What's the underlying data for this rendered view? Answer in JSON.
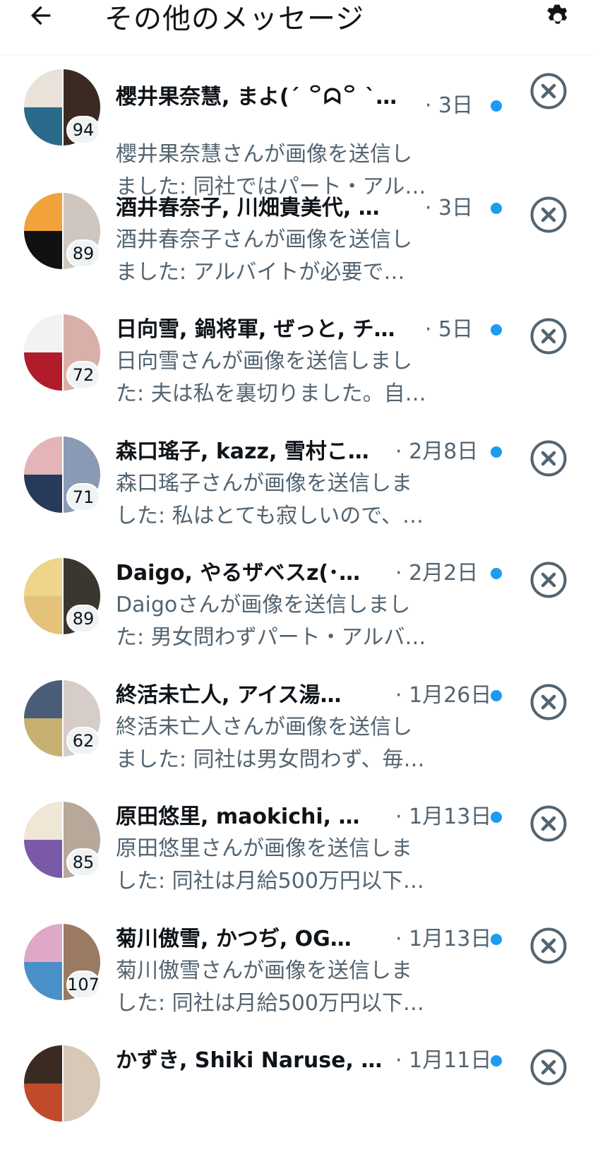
{
  "header": {
    "title": "その他のメッセージ",
    "back_icon": "arrow-left-icon",
    "settings_icon": "gear-icon"
  },
  "colors": {
    "unread_dot": "#1d9bf0",
    "muted_text": "#536471",
    "close_icon": "#536471"
  },
  "conversations": [
    {
      "names": "櫻井果奈慧, まよ(´ ꒪ᗣ꒪ `)…",
      "time": "· 3日",
      "preview_line1": "櫻井果奈慧さんが画像を送信し",
      "preview_line2": "ました: 同社ではパート・アル…",
      "member_count": "94",
      "unread": true
    },
    {
      "names": "酒井春奈子, 川畑貴美代, …",
      "time": "· 3日",
      "preview_line1": "酒井春奈子さんが画像を送信し",
      "preview_line2": "ました: アルバイトが必要で…",
      "member_count": "89",
      "unread": true
    },
    {
      "names": "日向雪, 鍋将軍, ぜっと, チ…",
      "time": "· 5日",
      "preview_line1": "日向雪さんが画像を送信しまし",
      "preview_line2": "た: 夫は私を裏切りました。自…",
      "member_count": "72",
      "unread": true
    },
    {
      "names": "森口瑤子, kazz, 雪村こ…",
      "time": "· 2月8日",
      "preview_line1": "森口瑤子さんが画像を送信しま",
      "preview_line2": "した: 私はとても寂しいので、…",
      "member_count": "71",
      "unread": true
    },
    {
      "names": "Daigo, やるザベスz(･…",
      "time": "· 2月2日",
      "preview_line1": "Daigoさんが画像を送信しまし",
      "preview_line2": "た: 男女問わずパート・アルバ…",
      "member_count": "89",
      "unread": true
    },
    {
      "names": "終活未亡人, アイス湯…",
      "time": "· 1月26日",
      "preview_line1": "終活未亡人さんが画像を送信し",
      "preview_line2": "ました: 同社は男女問わず、毎…",
      "member_count": "62",
      "unread": true
    },
    {
      "names": "原田悠里, maokichi, …",
      "time": "· 1月13日",
      "preview_line1": "原田悠里さんが画像を送信しま",
      "preview_line2": "した: 同社は月給500万円以下…",
      "member_count": "85",
      "unread": true
    },
    {
      "names": "菊川傲雪, かつぢ, OG…",
      "time": "· 1月13日",
      "preview_line1": "菊川傲雪さんが画像を送信しま",
      "preview_line2": "した: 同社は月給500万円以下…",
      "member_count": "107",
      "unread": true
    },
    {
      "names": "かずき, Shiki Naruse, …",
      "time": "· 1月11日",
      "preview_line1": "",
      "preview_line2": "",
      "member_count": "",
      "unread": true
    }
  ]
}
